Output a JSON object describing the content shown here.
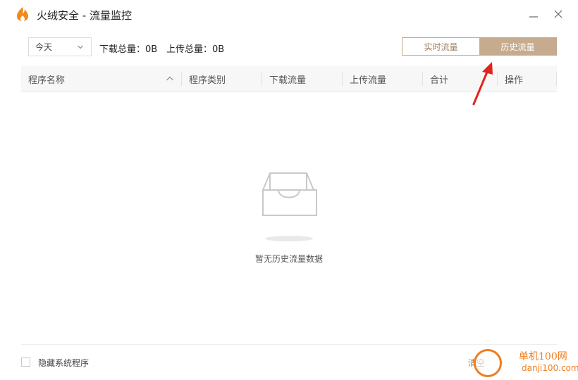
{
  "window": {
    "title": "火绒安全 - 流量监控",
    "icons": [
      "fire-logo-icon",
      "minimize-icon",
      "close-icon"
    ],
    "accent_color": "#c7ab8e"
  },
  "toolbar": {
    "date_select_value": "今天",
    "download_total": "下载总量：0B",
    "upload_total": "上传总量：0B",
    "tabs": [
      {
        "label": "实时流量",
        "active": false
      },
      {
        "label": "历史流量",
        "active": true
      }
    ]
  },
  "table": {
    "columns": [
      "程序名称",
      "程序类别",
      "下载流量",
      "上传流量",
      "合计",
      "操作"
    ]
  },
  "empty_state": {
    "message": "暂无历史流量数据",
    "icon": "empty-tray-icon"
  },
  "footer": {
    "hide_system_label": "隐藏系统程序",
    "hide_system_checked": false,
    "clear_label": "清空"
  },
  "watermark": {
    "line1": "单机100网",
    "line2": "danji100.com"
  }
}
